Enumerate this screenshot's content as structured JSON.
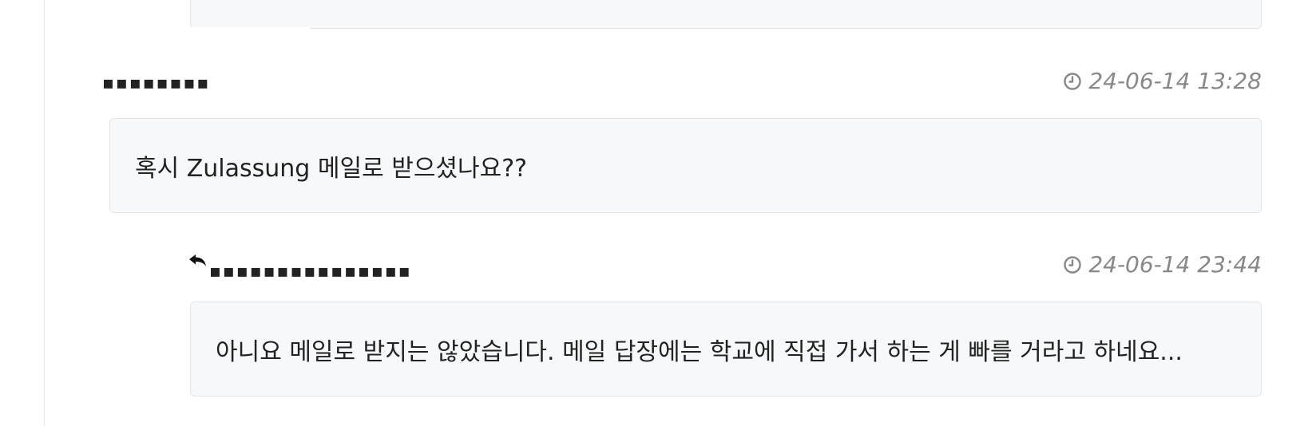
{
  "comments": [
    {
      "author": "▪▪▪▪▪▪▪▪",
      "timestamp": "24-06-14 13:28",
      "text": "혹시 Zulassung 메일로 받으셨나요??",
      "icons": {
        "time": "clock-icon"
      }
    },
    {
      "author": "▪▪▪▪▪▪▪▪▪▪▪▪▪▪▪",
      "timestamp": "24-06-14 23:44",
      "text": "아니요 메일로 받지는 않았습니다. 메일 답장에는 학교에 직접 가서 하는 게 빠를 거라고 하네요...",
      "icons": {
        "reply": "reply-arrow-icon",
        "time": "clock-icon"
      }
    }
  ],
  "colors": {
    "box_background": "#f6f8f9",
    "box_border": "#e3e6e8",
    "timestamp": "#888888",
    "text": "#222222"
  }
}
